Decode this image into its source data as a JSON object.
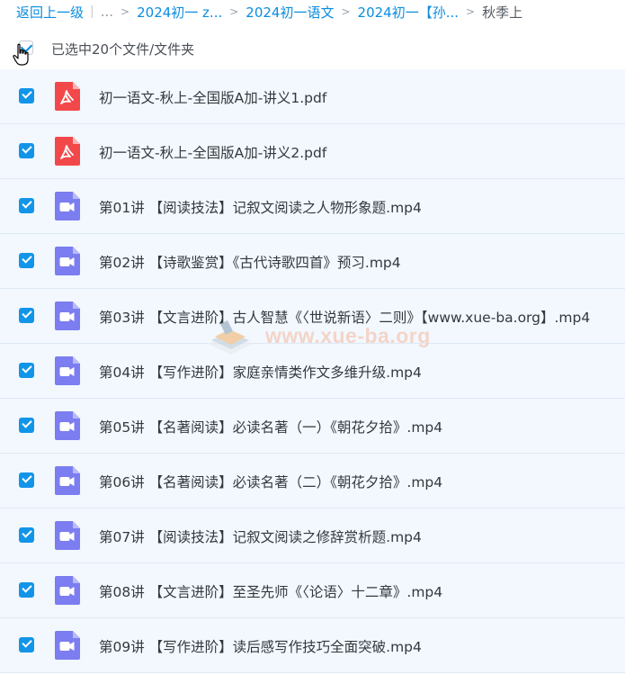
{
  "breadcrumb": {
    "back": "返回上一级",
    "ellipsis": "...",
    "items": [
      "2024初一 z...",
      "2024初一语文",
      "2024初一【孙..."
    ],
    "current": "秋季上"
  },
  "selection": {
    "label": "已选中20个文件/文件夹",
    "all_checked": true
  },
  "files": [
    {
      "name": "初一语文-秋上-全国版A加-讲义1.pdf",
      "type": "pdf",
      "checked": true
    },
    {
      "name": "初一语文-秋上-全国版A加-讲义2.pdf",
      "type": "pdf",
      "checked": true
    },
    {
      "name": "第01讲 【阅读技法】记叙文阅读之人物形象题.mp4",
      "type": "video",
      "checked": true
    },
    {
      "name": "第02讲 【诗歌鉴赏】《古代诗歌四首》预习.mp4",
      "type": "video",
      "checked": true
    },
    {
      "name": "第03讲 【文言进阶】古人智慧《〈世说新语〉二则》【www.xue-ba.org】.mp4",
      "type": "video",
      "checked": true
    },
    {
      "name": "第04讲 【写作进阶】家庭亲情类作文多维升级.mp4",
      "type": "video",
      "checked": true
    },
    {
      "name": "第05讲 【名著阅读】必读名著（一）《朝花夕拾》.mp4",
      "type": "video",
      "checked": true
    },
    {
      "name": "第06讲 【名著阅读】必读名著（二）《朝花夕拾》.mp4",
      "type": "video",
      "checked": true
    },
    {
      "name": "第07讲 【阅读技法】记叙文阅读之修辞赏析题.mp4",
      "type": "video",
      "checked": true
    },
    {
      "name": "第08讲 【文言进阶】至圣先师《〈论语〉十二章》.mp4",
      "type": "video",
      "checked": true
    },
    {
      "name": "第09讲 【写作进阶】读后感写作技巧全面突破.mp4",
      "type": "video",
      "checked": true
    }
  ],
  "watermark": "www.xue-ba.org",
  "icons": {
    "pdf": "pdf-file-icon",
    "video": "video-file-icon",
    "cursor": "hand-pointer-icon"
  },
  "colors": {
    "accent": "#1295e8",
    "link": "#0a8de0",
    "row_background": "#f2f8fe",
    "pdf": "#f2484a",
    "video": "#7b7df0"
  }
}
